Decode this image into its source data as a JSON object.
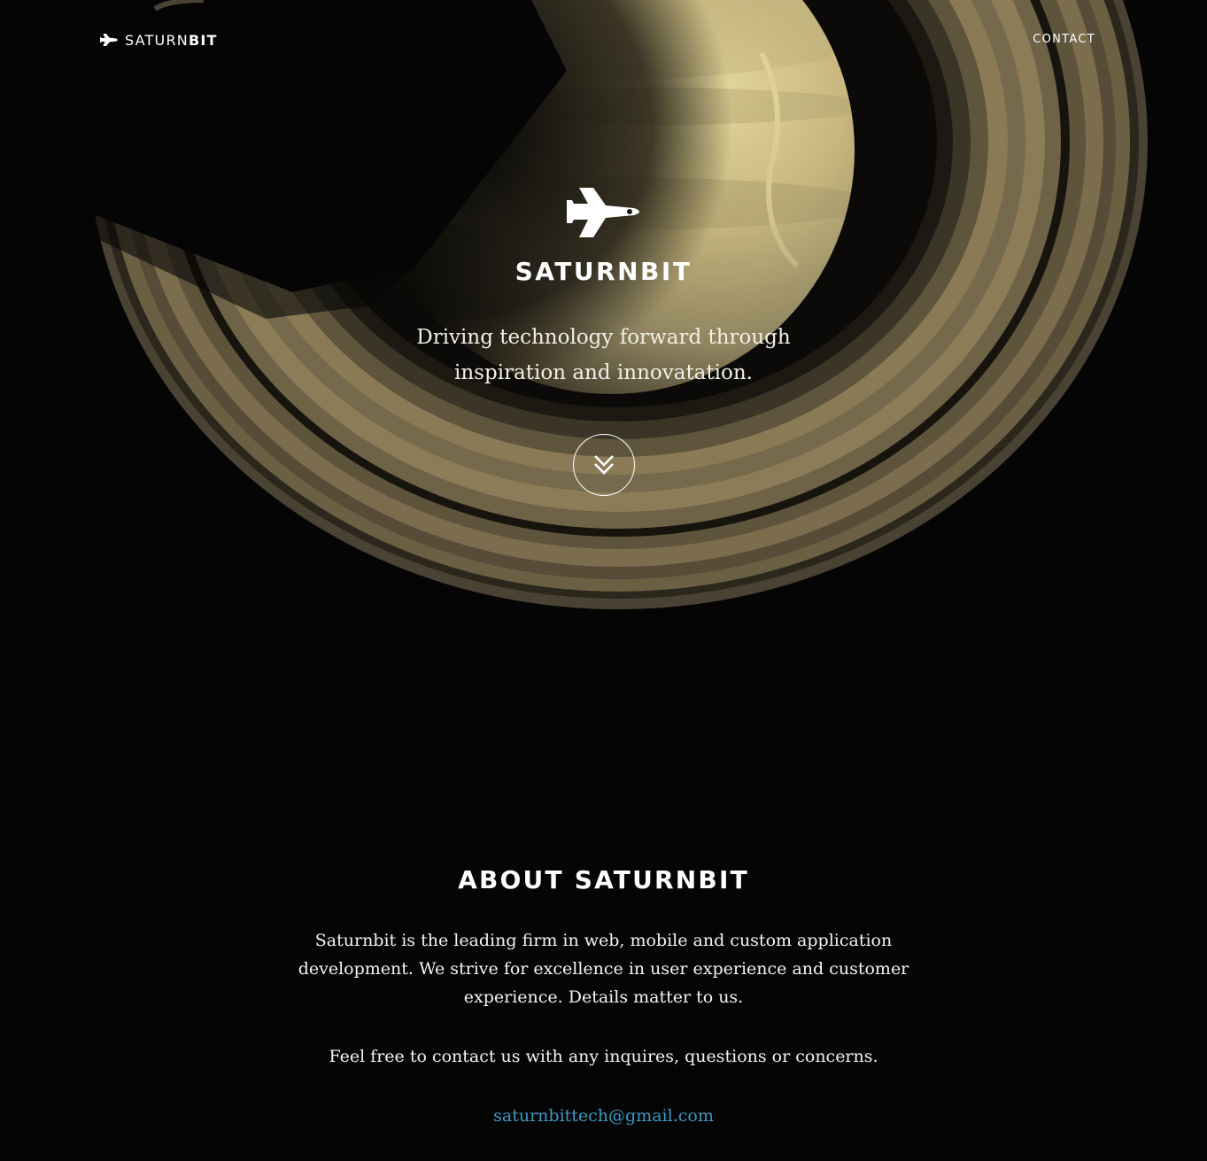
{
  "nav": {
    "brand_light": "SATURN",
    "brand_bold": "BIT",
    "contact_label": "CONTACT"
  },
  "hero": {
    "title": "SATURNBIT",
    "tagline": "Driving technology forward through inspiration and innovatation."
  },
  "about": {
    "title": "ABOUT SATURNBIT",
    "paragraph": "Saturnbit is the leading firm in web, mobile and custom application development. We strive for excellence in user experience and customer experience. Details matter to us.",
    "contact_line": "Feel free to contact us with any inquires, questions or concerns.",
    "email": "saturnbittech@gmail.com"
  },
  "icons": {
    "brand_logo": "space-shuttle-icon",
    "hero_logo": "space-shuttle-icon",
    "scroll_button": "double-chevron-down-icon"
  },
  "colors": {
    "background": "#050505",
    "text": "#ffffff",
    "link": "#3d98c2",
    "planet": "#d8c98a",
    "rings": "#7a6c4c"
  }
}
